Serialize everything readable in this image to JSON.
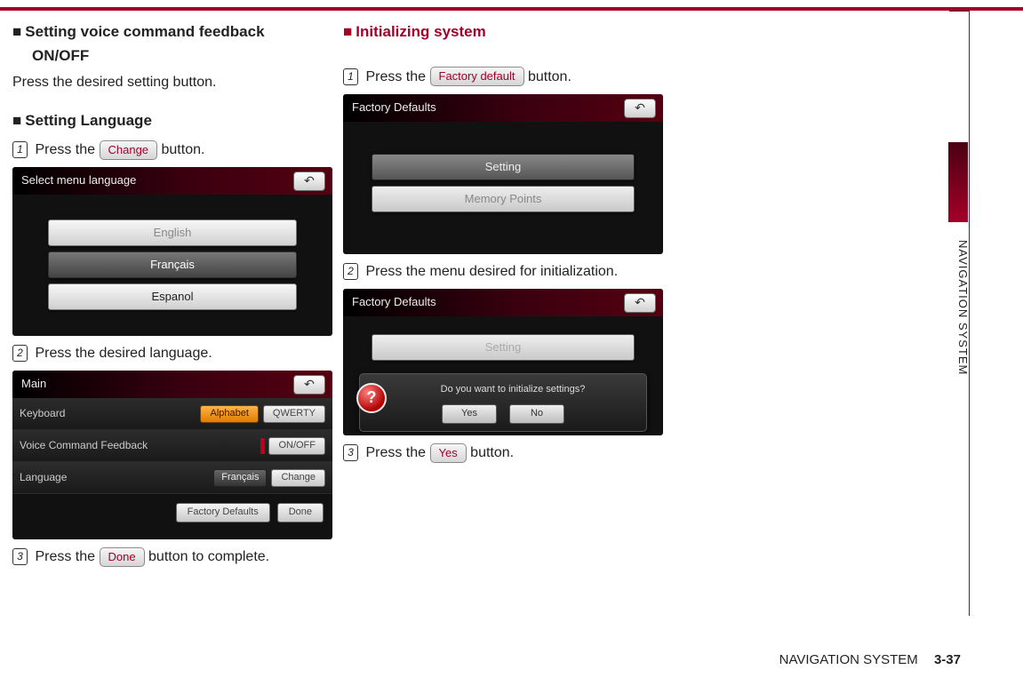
{
  "header_bar_color": "#a40028",
  "side": {
    "label": "NAVIGATION SYSTEM"
  },
  "footer": {
    "section": "NAVIGATION SYSTEM",
    "page": "3-37"
  },
  "left": {
    "h1_line1": "Setting voice command feedback",
    "h1_line2": "ON/OFF",
    "h1_body": "Press the desired setting button.",
    "h2": "Setting Language",
    "s1_pre": "Press the",
    "s1_btn": "Change",
    "s1_post": "button.",
    "lang_panel": {
      "title": "Select menu language",
      "back_glyph": "↶",
      "items": [
        {
          "label": "English",
          "style": "light-dim"
        },
        {
          "label": "Français",
          "style": "dark"
        },
        {
          "label": "Espanol",
          "style": "light-active"
        }
      ]
    },
    "s2": "Press the desired language.",
    "main_panel": {
      "title": "Main",
      "back_glyph": "↶",
      "rows": {
        "keyboard": {
          "label": "Keyboard",
          "opt1": "Alphabet",
          "opt2": "QWERTY"
        },
        "voice": {
          "label": "Voice Command Feedback",
          "toggle": "ON/OFF"
        },
        "language": {
          "label": "Language",
          "value": "Français",
          "action": "Change"
        }
      },
      "bottom": {
        "factory": "Factory Defaults",
        "done": "Done"
      }
    },
    "s3_pre": "Press the",
    "s3_btn": "Done",
    "s3_post": "button to complete."
  },
  "right": {
    "h1": "Initializing system",
    "s1_pre": "Press the",
    "s1_btn": "Factory default",
    "s1_post": "button.",
    "fd_panel": {
      "title": "Factory Defaults",
      "back_glyph": "↶",
      "items": [
        {
          "label": "Setting",
          "style": "dark"
        },
        {
          "label": "Memory Points",
          "style": "light"
        }
      ]
    },
    "s2": "Press the menu desired for initialization.",
    "fd_panel2": {
      "title": "Factory Defaults",
      "back_glyph": "↶",
      "dim_item": "Setting",
      "modal": {
        "icon": "?",
        "msg": "Do you want to initialize settings?",
        "yes": "Yes",
        "no": "No"
      }
    },
    "s3_pre": "Press the",
    "s3_btn": "Yes",
    "s3_post": "button."
  }
}
